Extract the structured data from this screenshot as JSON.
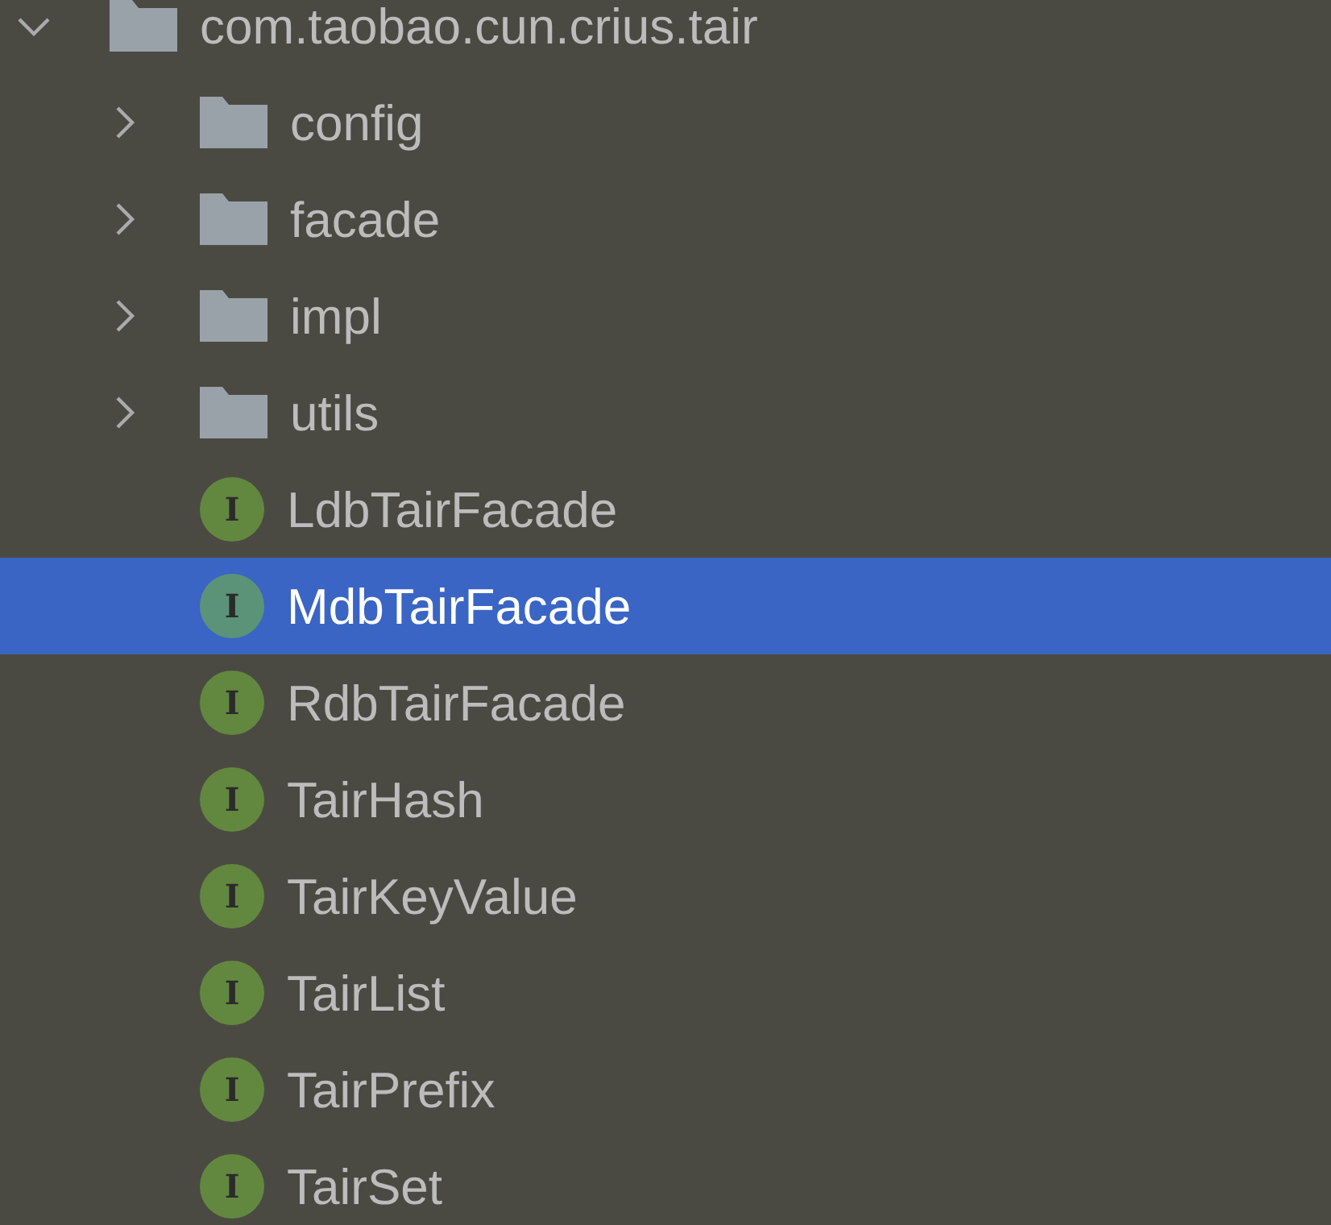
{
  "tree": [
    {
      "label": "com.taobao.cun.crius.tair",
      "kind": "folder",
      "expanded": true,
      "selected": false,
      "children": [
        {
          "label": "config",
          "kind": "folder",
          "expanded": false,
          "selected": false
        },
        {
          "label": "facade",
          "kind": "folder",
          "expanded": false,
          "selected": false
        },
        {
          "label": "impl",
          "kind": "folder",
          "expanded": false,
          "selected": false
        },
        {
          "label": "utils",
          "kind": "folder",
          "expanded": false,
          "selected": false
        },
        {
          "label": "LdbTairFacade",
          "kind": "interface",
          "badge": "I",
          "selected": false
        },
        {
          "label": "MdbTairFacade",
          "kind": "interface",
          "badge": "I",
          "selected": true
        },
        {
          "label": "RdbTairFacade",
          "kind": "interface",
          "badge": "I",
          "selected": false
        },
        {
          "label": "TairHash",
          "kind": "interface",
          "badge": "I",
          "selected": false
        },
        {
          "label": "TairKeyValue",
          "kind": "interface",
          "badge": "I",
          "selected": false
        },
        {
          "label": "TairList",
          "kind": "interface",
          "badge": "I",
          "selected": false
        },
        {
          "label": "TairPrefix",
          "kind": "interface",
          "badge": "I",
          "selected": false
        },
        {
          "label": "TairSet",
          "kind": "interface",
          "badge": "I",
          "selected": false
        }
      ]
    }
  ]
}
